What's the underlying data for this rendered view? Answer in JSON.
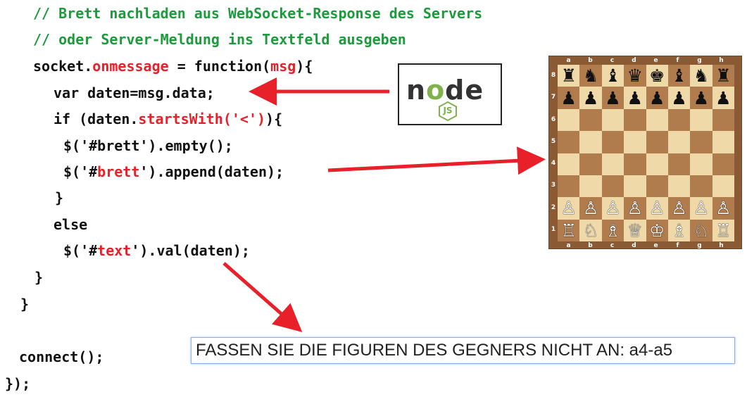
{
  "code": {
    "comment_1": "// Brett nachladen aus WebSocket-Response des Servers",
    "comment_2": "// oder Server-Meldung ins Textfeld ausgeben",
    "line_socket_pre": "socket.",
    "line_socket_onmessage": "onmessage",
    "line_socket_mid": " = function(",
    "line_socket_msg": "msg",
    "line_socket_post": "){",
    "line_var": "var daten=msg.data;",
    "line_if_pre": "if (daten.",
    "line_if_startswith": "startsWith('<')",
    "line_if_post": "){",
    "line_empty": "$('#brett').empty();",
    "line_append_pre": "$('#",
    "line_append_brett": "brett",
    "line_append_post": "').append(daten);",
    "line_close_if": "}",
    "line_else": "else",
    "line_val_pre": "$('#",
    "line_val_text": "text",
    "line_val_post": "').val(daten);",
    "line_close_fn": "}",
    "line_close_outer": "}",
    "line_connect": "connect();",
    "line_end": "});"
  },
  "node_logo": {
    "word_n": "n",
    "word_o": "o",
    "word_de": "de",
    "badge": "JS"
  },
  "board": {
    "files": [
      "a",
      "b",
      "c",
      "d",
      "e",
      "f",
      "g",
      "h"
    ],
    "ranks": [
      "8",
      "7",
      "6",
      "5",
      "4",
      "3",
      "2",
      "1"
    ],
    "pieces": [
      [
        "♜",
        "♞",
        "♝",
        "♛",
        "♚",
        "♝",
        "♞",
        "♜"
      ],
      [
        "♟",
        "♟",
        "♟",
        "♟",
        "♟",
        "♟",
        "♟",
        "♟"
      ],
      [
        "",
        "",
        "",
        "",
        "",
        "",
        "",
        ""
      ],
      [
        "",
        "",
        "",
        "",
        "",
        "",
        "",
        ""
      ],
      [
        "",
        "",
        "",
        "",
        "",
        "",
        "",
        ""
      ],
      [
        "",
        "",
        "",
        "",
        "",
        "",
        "",
        ""
      ],
      [
        "♙",
        "♙",
        "♙",
        "♙",
        "♙",
        "♙",
        "♙",
        "♙"
      ],
      [
        "♖",
        "♘",
        "♗",
        "♕",
        "♔",
        "♗",
        "♘",
        "♖"
      ]
    ]
  },
  "text_field": {
    "value": "FASSEN SIE DIE FIGUREN DES GEGNERS NICHT AN: a4-a5"
  },
  "colors": {
    "comment": "#1e9a3e",
    "highlight": "#e8202a",
    "arrow": "#e8202a",
    "board_light": "#f0d9a8",
    "board_dark": "#b07c4e"
  }
}
